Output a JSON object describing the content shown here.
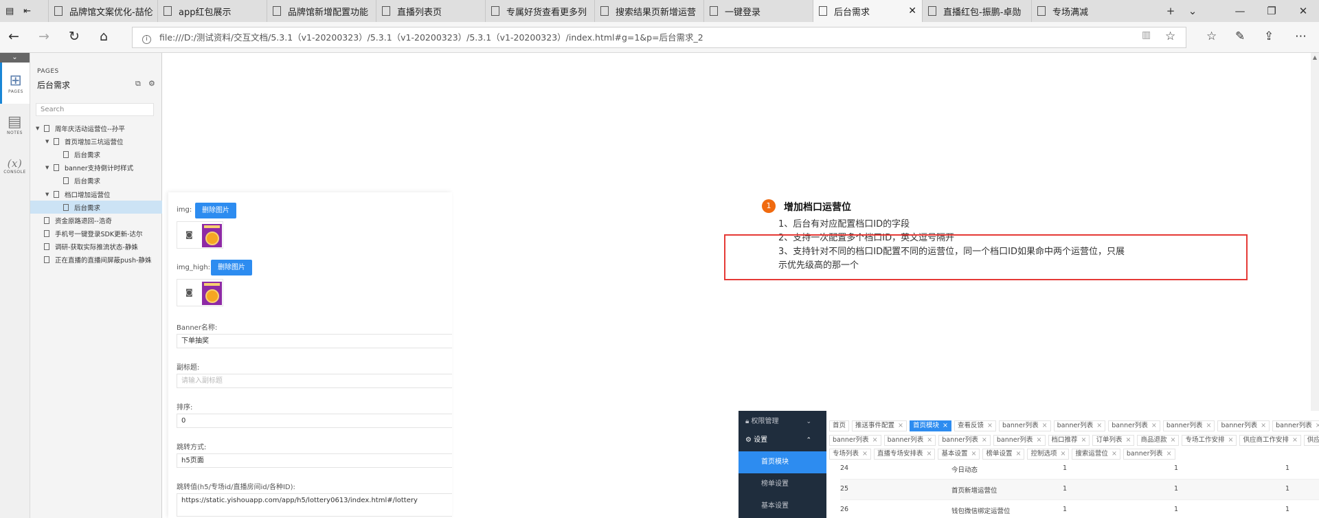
{
  "browser": {
    "tabs": [
      {
        "label": "品牌馆文案优化-喆伦"
      },
      {
        "label": "app红包展示"
      },
      {
        "label": "品牌馆新增配置功能"
      },
      {
        "label": "直播列表页"
      },
      {
        "label": "专属好货查看更多列"
      },
      {
        "label": "搜索结果页新增运营"
      },
      {
        "label": "一键登录"
      },
      {
        "label": "后台需求"
      },
      {
        "label": "直播红包-振鹏-卓勋"
      },
      {
        "label": "专场满减"
      }
    ],
    "url": "file:///D:/测试资料/交互文档/5.3.1（v1-20200323）/5.3.1（v1-20200323）/5.3.1（v1-20200323）/index.html#g=1&p=后台需求_2"
  },
  "axure": {
    "rail": [
      {
        "label": "PAGES"
      },
      {
        "label": "NOTES"
      },
      {
        "label": "CONSOLE"
      }
    ],
    "pages_label": "PAGES",
    "pages_title": "后台需求",
    "search_placeholder": "Search",
    "tree": [
      {
        "label": "周年庆活动运营位--孙平"
      },
      {
        "label": "首页增加三坑运营位"
      },
      {
        "label": "后台需求"
      },
      {
        "label": "banner支持倒计时样式"
      },
      {
        "label": "后台需求"
      },
      {
        "label": "档口增加运营位"
      },
      {
        "label": "后台需求"
      },
      {
        "label": "资金原路退回--浩奇"
      },
      {
        "label": "手机号一键登录SDK更新-达尔"
      },
      {
        "label": "调研-获取实际推流状态-静姝"
      },
      {
        "label": "正在直播的直播间屏蔽push-静姝"
      }
    ]
  },
  "form": {
    "img_label": "img:",
    "img_high_label": "img_high:",
    "delete_btn": "删除图片",
    "thumb_caption": "一起抽奖",
    "banner_name_label": "Banner名称:",
    "banner_name_value": "下单抽奖",
    "subtitle_label": "副标题:",
    "subtitle_placeholder": "请输入副标题",
    "sort_label": "排序:",
    "sort_value": "0",
    "jump_type_label": "跳转方式:",
    "jump_type_value": "h5页面",
    "jump_value_label": "跳转值(h5/专场id/直播房间id/各种ID):",
    "jump_value": "https://static.yishouapp.com/app/h5/lottery0613/index.html#/lottery"
  },
  "note": {
    "number": "1",
    "title": "增加档口运营位",
    "lines": [
      "1、后台有对应配置档口ID的字段",
      "2、支持一次配置多个档口ID，英文逗号隔开",
      "3、支持针对不同的档口ID配置不同的运营位，同一个档口ID如果命中两个运营位，只展",
      "示优先级高的那一个"
    ]
  },
  "admin": {
    "menu": {
      "perm": "权限管理",
      "settings": "设置",
      "home_module": "首页模块",
      "rank_settings": "榜单设置",
      "basic_settings": "基本设置"
    },
    "tags_row1": [
      "首页",
      "推送事件配置",
      "首页模块",
      "查看反馈",
      "banner列表",
      "banner列表",
      "banner列表",
      "banner列表",
      "banner列表",
      "banner列表"
    ],
    "tags_row2": [
      "banner列表",
      "banner列表",
      "banner列表",
      "banner列表",
      "档口推荐",
      "订单列表",
      "商品退款",
      "专场工作安排",
      "供应商工作安排",
      "供应商"
    ],
    "tags_row3": [
      "专场列表",
      "直播专场安排表",
      "基本设置",
      "榜单设置",
      "控制选项",
      "搜索运营位",
      "banner列表"
    ],
    "rows": [
      {
        "id": "24",
        "name": "今日动态",
        "a": "1",
        "b": "1",
        "c": "1"
      },
      {
        "id": "25",
        "name": "首页新增运营位",
        "a": "1",
        "b": "1",
        "c": "1"
      },
      {
        "id": "26",
        "name": "钱包微信绑定运营位",
        "a": "1",
        "b": "1",
        "c": "1"
      }
    ]
  }
}
